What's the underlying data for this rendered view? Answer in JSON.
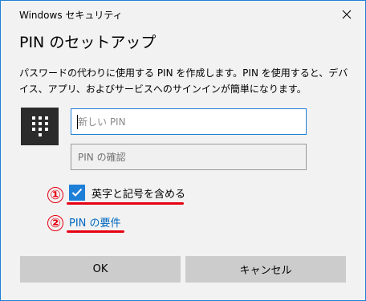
{
  "window": {
    "title": "Windows セキュリティ",
    "close_icon": "close-icon"
  },
  "dialog": {
    "heading": "PIN のセットアップ",
    "description": "パスワードの代わりに使用する PIN を作成します。PIN を使用すると、デバイス、アプリ、およびサービスへのサインインが簡単になります。",
    "keypad_icon": "keypad-icon",
    "new_pin": {
      "placeholder": "新しい PIN",
      "value": ""
    },
    "confirm_pin": {
      "placeholder": "PIN の確認",
      "value": ""
    },
    "include_letters_symbols": {
      "label": "英字と記号を含める",
      "checked": true
    },
    "pin_requirements_link": "PIN の要件",
    "buttons": {
      "ok": "OK",
      "cancel": "キャンセル"
    }
  },
  "annotations": [
    {
      "marker": "①",
      "color": "#e60012"
    },
    {
      "marker": "②",
      "color": "#e60012"
    }
  ],
  "colors": {
    "accent": "#1e7fd8",
    "annotation": "#e60012",
    "link": "#0067c0",
    "background": "#f2f2f2",
    "button": "#cccccc"
  }
}
